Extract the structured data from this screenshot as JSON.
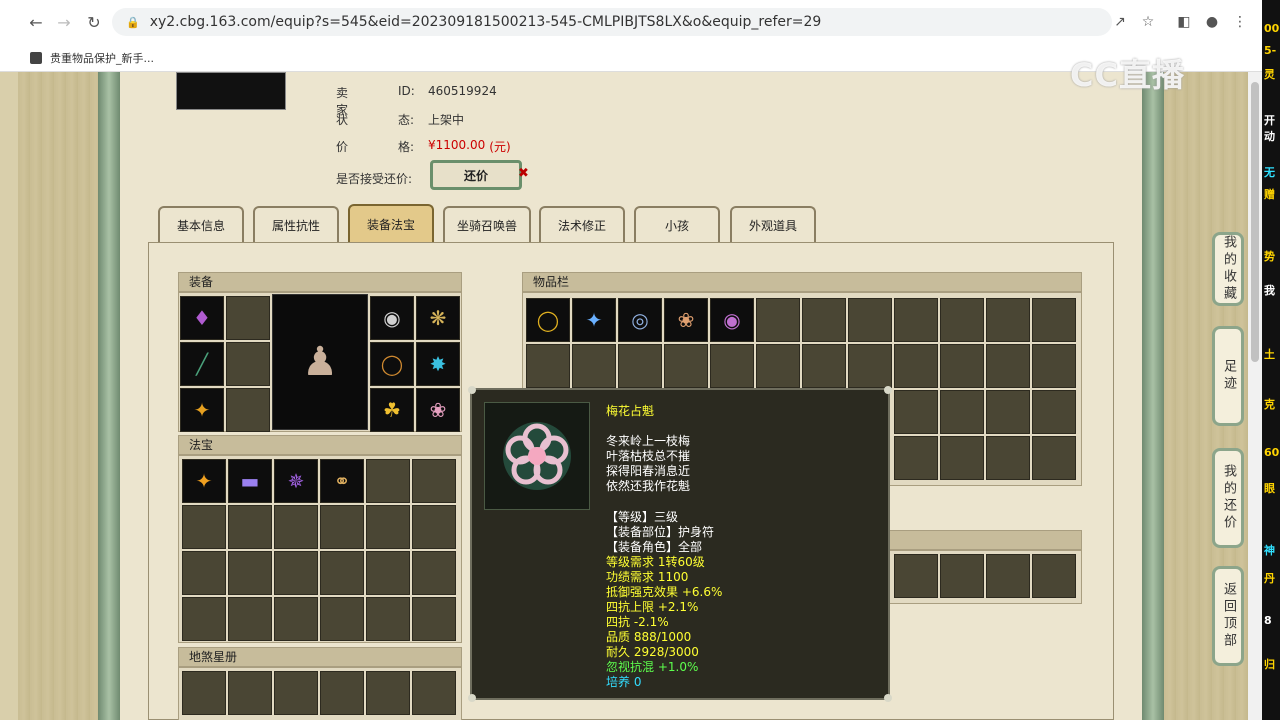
{
  "browser": {
    "url": "xy2.cbg.163.com/equip?s=545&eid=202309181500213-545-CMLPIBJTS8LX&o&equip_refer=29",
    "bookmark": "贵重物品保护_新手..."
  },
  "watermark": "CC直播",
  "equip": {
    "seller_label": "卖 家",
    "seller_id_label": "ID:",
    "seller_id": "460519924",
    "status_label": "状",
    "status_label2": "态:",
    "status_value": "上架中",
    "price_label": "价",
    "price_label2": "格:",
    "price_value": "¥1100.00",
    "price_unit": "(元)",
    "bargain_label": "是否接受还价:",
    "bargain_button": "还价"
  },
  "tabs": [
    {
      "label": "基本信息"
    },
    {
      "label": "属性抗性"
    },
    {
      "label": "装备法宝"
    },
    {
      "label": "坐骑召唤兽"
    },
    {
      "label": "法术修正"
    },
    {
      "label": "小孩"
    },
    {
      "label": "外观道具"
    }
  ],
  "sections": {
    "equipment": "装备",
    "inventory": "物品栏",
    "fabao": "法宝",
    "stars": "地煞星册"
  },
  "side_buttons": [
    {
      "label": "我的收藏"
    },
    {
      "label": "足迹"
    },
    {
      "label": "我的还价"
    },
    {
      "label": "返回顶部"
    }
  ],
  "tooltip": {
    "name": "梅花占魁",
    "poem": [
      "冬来岭上一枝梅",
      "叶落枯枝总不摧",
      "探得阳春消息近",
      "依然还我作花魁"
    ],
    "level": "【等级】三级",
    "slot": "【装备部位】护身符",
    "role": "【装备角色】全部",
    "req_level": "等级需求 1转60级",
    "req_merit": "功绩需求 1100",
    "attr1": "抵御强克效果 +6.6%",
    "attr2": "四抗上限 +2.1%",
    "attr3": "四抗 -2.1%",
    "quality": "品质 888/1000",
    "durability": "耐久 2928/3000",
    "ignore": "忽视抗混 +1.0%",
    "nurture": "培养 0"
  },
  "right_strip": [
    "00",
    "5-",
    "灵",
    "开",
    "动",
    "无",
    "赠",
    "势",
    "我",
    "土",
    "克",
    "60",
    "眼",
    "神",
    "丹",
    "8",
    "归"
  ],
  "colors": {
    "price": "#cc0000",
    "tooltip_bg": "#2b2a20",
    "tab_active": "#e3c98a",
    "frame_green": "#8ca58a"
  }
}
